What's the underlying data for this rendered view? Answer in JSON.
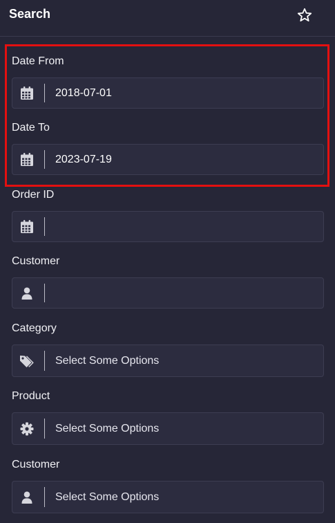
{
  "header": {
    "title": "Search",
    "favorite_icon": "star-outline-icon"
  },
  "colors": {
    "background": "#262637",
    "field_background": "#2c2c3f",
    "highlight_border": "#e31010"
  },
  "fields": [
    {
      "label": "Date From",
      "value": "2018-07-01",
      "icon": "calendar-icon"
    },
    {
      "label": "Date To",
      "value": "2023-07-19",
      "icon": "calendar-icon"
    },
    {
      "label": "Order ID",
      "value": "",
      "icon": "calendar-icon"
    },
    {
      "label": "Customer",
      "value": "",
      "icon": "user-icon"
    },
    {
      "label": "Category",
      "placeholder": "Select Some Options",
      "icon": "tags-icon"
    },
    {
      "label": "Product",
      "placeholder": "Select Some Options",
      "icon": "gear-icon"
    },
    {
      "label": "Customer",
      "placeholder": "Select Some Options",
      "icon": "user-icon"
    }
  ]
}
